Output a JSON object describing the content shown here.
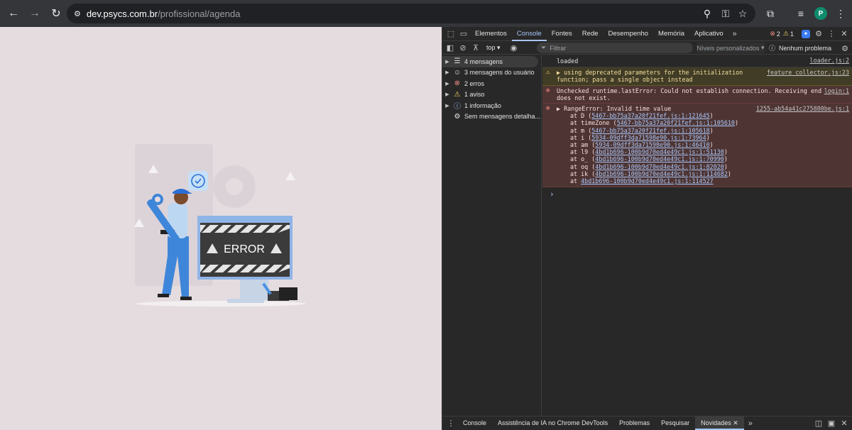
{
  "browser": {
    "url_host": "dev.psycs.com.br",
    "url_path": "/profissional/agenda",
    "avatar_letter": "P",
    "icons": [
      "back-icon",
      "forward-icon",
      "reload-icon",
      "site-info-icon",
      "zoom-icon",
      "password-key-icon",
      "bookmark-star-icon",
      "extensions-icon",
      "media-icon",
      "menu-icon"
    ]
  },
  "page": {
    "illustration_text": "ERROR"
  },
  "devtools": {
    "tabs": [
      "Elementos",
      "Console",
      "Fontes",
      "Rede",
      "Desempenho",
      "Memória",
      "Aplicativo"
    ],
    "error_count": "2",
    "warning_count": "1",
    "context": "top",
    "filter_placeholder": "Filtrar",
    "levels": "Níveis personalizados",
    "issues": "Nenhum problema",
    "sidebar": [
      {
        "label": "4 mensagens",
        "icon": "list-icon"
      },
      {
        "label": "3 mensagens do usuário",
        "icon": "user-icon"
      },
      {
        "label": "2 erros",
        "icon": "error-icon"
      },
      {
        "label": "1 aviso",
        "icon": "warning-icon"
      },
      {
        "label": "1 informação",
        "icon": "info-icon"
      },
      {
        "label": "Sem mensagens detalha...",
        "icon": "bug-icon"
      }
    ],
    "messages": {
      "m1": {
        "text": "loaded",
        "source": "loader.js:2"
      },
      "m2": {
        "text1": "▶ using deprecated parameters for the initialization",
        "text2": "function; pass a single object instead",
        "source": "feature_collector.js:23"
      },
      "m3": {
        "text1": "Unchecked runtime.lastError: Could not establish connection. Receiving end",
        "text2": "does not exist.",
        "source": "login:1"
      },
      "m4": {
        "text": "▶ RangeError: Invalid time value",
        "source": "1255-ab54a41c275880be.js:1",
        "stack": [
          {
            "fn": "at D (",
            "link": "5467-bb75a37a20f21fef.js:1:121645",
            "end": ")"
          },
          {
            "fn": "at timeZone (",
            "link": "5467-bb75a37a20f21fef.js:1:105610",
            "end": ")"
          },
          {
            "fn": "at m (",
            "link": "5467-bb75a37a20f21fef.js:1:105618",
            "end": ")"
          },
          {
            "fn": "at i (",
            "link": "5934-09dff3da71598e90.js:1:73964",
            "end": ")"
          },
          {
            "fn": "at am (",
            "link": "5934-09dff3da71598e90.js:1:46410",
            "end": ")"
          },
          {
            "fn": "at l9 (",
            "link": "4bd1b696-100b9d70ed4e49c1.js:1:51130",
            "end": ")"
          },
          {
            "fn": "at o_ (",
            "link": "4bd1b696-100b9d70ed4e49c1.js:1:70990",
            "end": ")"
          },
          {
            "fn": "at oq (",
            "link": "4bd1b696-100b9d70ed4e49c1.js:1:82020",
            "end": ")"
          },
          {
            "fn": "at ik (",
            "link": "4bd1b696-100b9d70ed4e49c1.js:1:114682",
            "end": ")"
          },
          {
            "fn": "at ",
            "link": "4bd1b696-100b9d70ed4e49c1.js:1:114527",
            "end": ""
          }
        ]
      }
    },
    "prompt": "›",
    "bottom_tabs": [
      "Console",
      "Assistência de IA no Chrome DevTools",
      "Problemas",
      "Pesquisar",
      "Novidades"
    ]
  }
}
